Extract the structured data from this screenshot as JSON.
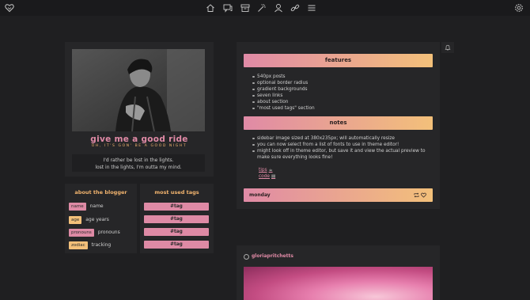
{
  "topbar": {
    "icons": [
      "heart-logo-icon",
      "home-icon",
      "chat-icon",
      "archive-icon",
      "magic-wand-icon",
      "user-icon",
      "link-icon",
      "menu-icon",
      "settings-icon"
    ]
  },
  "sidebar": {
    "title": "give me a good ride",
    "subtitle": "OH, IT'S GON' BE A GOOD NIGHT",
    "description_line1": "I'd rather be lost in the lights.",
    "description_line2": "lost in the lights, I'm outta my mind."
  },
  "about": {
    "heading": "about the blogger",
    "rows": [
      {
        "chip": "name",
        "text": "name",
        "color": "#de8aa5"
      },
      {
        "chip": "age",
        "text": "age years",
        "color": "#f3c07a"
      },
      {
        "chip": "pronouns",
        "text": "pronouns",
        "color": "#de8aa5"
      },
      {
        "chip": "zodiac",
        "text": "tracking",
        "color": "#f3c07a"
      }
    ]
  },
  "tags": {
    "heading": "most used tags",
    "items": [
      "#tag",
      "#tag",
      "#tag",
      "#tag"
    ]
  },
  "post": {
    "features_heading": "features",
    "features": [
      "540px posts",
      "optional border radius",
      "gradient backgrounds",
      "seven links",
      "about section",
      "\"most used tags\" section"
    ],
    "notes_heading": "notes",
    "notes": [
      "sidebar image sized at 380x235px; will automatically resize",
      "you can now select from a list of fonts to use in theme editor!",
      "might look off in theme editor, but save it and view the actual preview to make sure everything looks fine!"
    ],
    "link_tips": "tips",
    "link_tips_glyph": "☕",
    "link_code": "code",
    "link_code_glyph": "▤",
    "date": "monday"
  },
  "post2": {
    "username": "gloriapritchetts"
  },
  "colors": {
    "pink": "#e08aa6",
    "peach": "#f3c07a",
    "background": "#1f1f21",
    "panel": "#262628"
  }
}
